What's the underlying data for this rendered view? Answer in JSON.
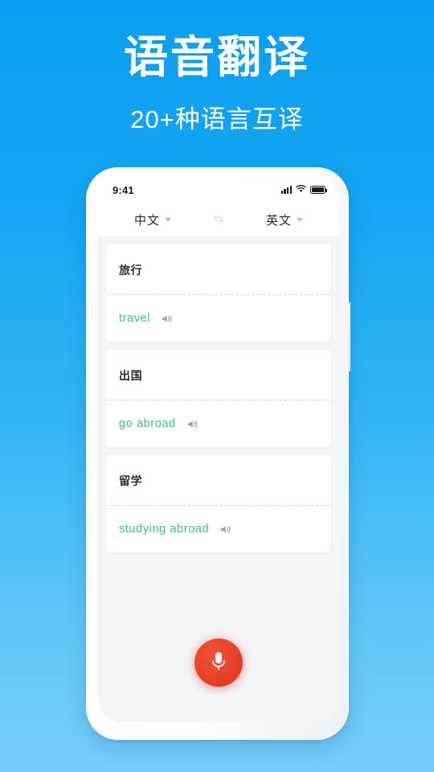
{
  "promo": {
    "title": "语音翻译",
    "subtitle": "20+种语言互译"
  },
  "phone": {
    "status_bar": {
      "time": "9:41",
      "signal_icon": "signal-bars-icon",
      "wifi_icon": "wifi-icon",
      "battery_icon": "battery-full-icon"
    },
    "language_bar": {
      "source_language": "中文",
      "target_language": "英文",
      "swap_icon": "swap-arrows-icon",
      "caret_icon": "chevron-down-icon"
    },
    "cards": [
      {
        "source": "旅行",
        "translation": "travel",
        "speaker_icon": "speaker-icon"
      },
      {
        "source": "出国",
        "translation": "go abroad",
        "speaker_icon": "speaker-icon"
      },
      {
        "source": "留学",
        "translation": "studying abroad",
        "speaker_icon": "speaker-icon"
      }
    ],
    "mic_button": {
      "icon": "microphone-icon",
      "label": ""
    }
  },
  "colors": {
    "background_top": "#0c9ef0",
    "background_bottom": "#77cdf9",
    "translation_green": "#37c193",
    "mic_red": "#e8412a",
    "screen_gray": "#f4f5f7"
  }
}
